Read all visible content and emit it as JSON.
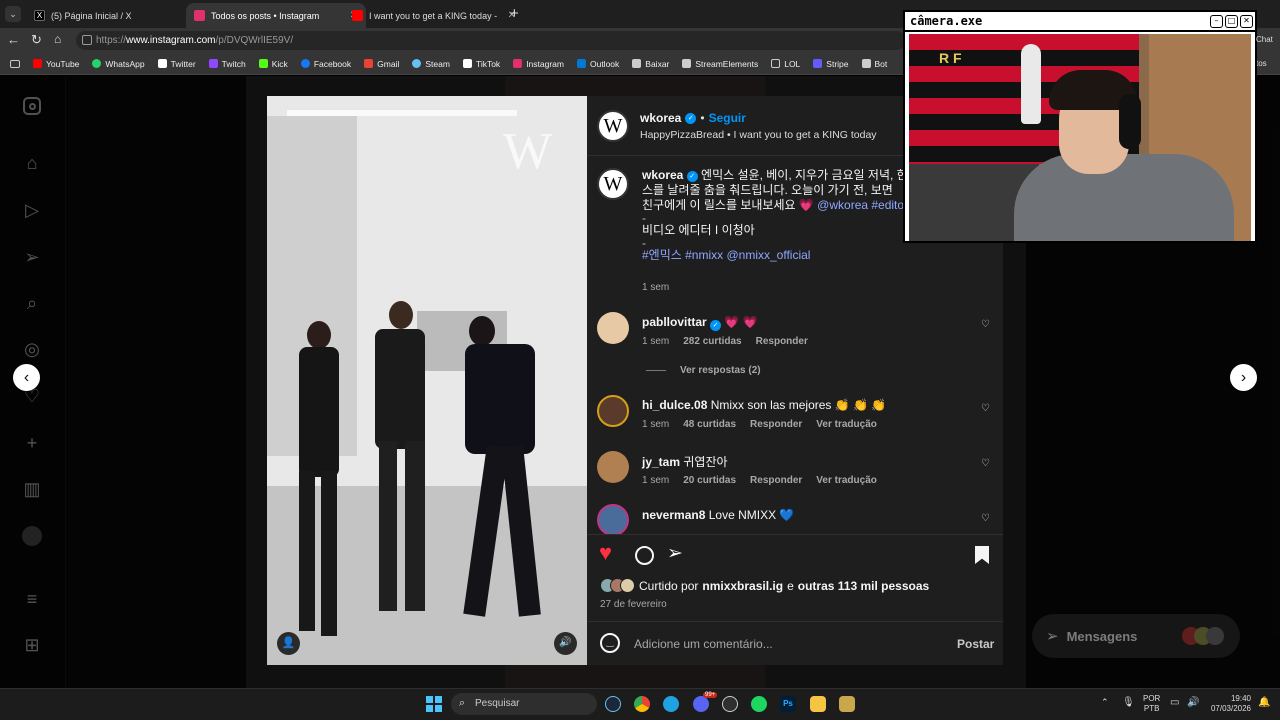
{
  "browser": {
    "tabs": [
      {
        "label": "(5) Página Inicial / X",
        "color": "#000000"
      },
      {
        "label": "Todos os posts • Instagram",
        "color": "#e1306c"
      },
      {
        "label": "I want you to get a KING today - Y",
        "color": "#ff0000"
      }
    ],
    "url_prefix": "https://",
    "url_domain": "www.instagram.com",
    "url_path": "/p/DVQWrlIE59V/",
    "bookmarks": [
      {
        "label": "YouTube",
        "color": "#ff0000"
      },
      {
        "label": "WhatsApp",
        "color": "#25d366"
      },
      {
        "label": "Twitter",
        "color": "#ffffff"
      },
      {
        "label": "Twitch",
        "color": "#9146ff"
      },
      {
        "label": "Kick",
        "color": "#53fc18"
      },
      {
        "label": "Facebook",
        "color": "#1877f2"
      },
      {
        "label": "Gmail",
        "color": "#ea4335"
      },
      {
        "label": "Steam",
        "color": "#66c0f4"
      },
      {
        "label": "TikTok",
        "color": "#ffffff"
      },
      {
        "label": "Instagram",
        "color": "#e1306c"
      },
      {
        "label": "Outlook",
        "color": "#0078d4"
      },
      {
        "label": "Baixar",
        "color": "#cccccc"
      },
      {
        "label": "StreamElements",
        "color": "#cccccc"
      },
      {
        "label": "LOL",
        "color": "#cccccc"
      },
      {
        "label": "Stripe",
        "color": "#635bff"
      },
      {
        "label": "Bot",
        "color": "#cccccc"
      }
    ],
    "overflow_text": "tos",
    "chat_text": "Chat"
  },
  "post": {
    "header_user": "wkorea",
    "follow": "Seguir",
    "audio": "HappyPizzaBread • I want you to get a KING today",
    "caption_user": "wkorea",
    "caption_line1": "엔믹스 설윤, 베이, 지우가 금요일 저녁, 한",
    "caption_line2": "스를 날려줄 춤을 춰드립니다. 오늘이 가기 전, 보면",
    "caption_line3": "친구에게 이 릴스를 보내보세요",
    "caption_tags1": "@wkorea #editor",
    "caption_dash1": "-",
    "caption_editor": "비디오 에디터 I 이청아",
    "caption_dash2": "-",
    "caption_tags2": "#엔믹스 #nmixx @nmixx_official",
    "caption_time": "1 sem",
    "likes_prefix": "Curtido por",
    "likes_user": "nmixxbrasil.ig",
    "likes_mid": "e",
    "likes_rest": "outras 113 mil pessoas",
    "date": "27 de fevereiro",
    "comment_placeholder": "Adicione um comentário...",
    "post_button": "Postar",
    "brand_letter": "W"
  },
  "comments": [
    {
      "user": "pabllovittar",
      "text": "💗 💗",
      "time": "1 sem",
      "likes": "282 curtidas",
      "reply": "Responder",
      "translate": "",
      "replies": "Ver respostas (2)"
    },
    {
      "user": "hi_dulce.08",
      "text": "Nmixx son las mejores 👏 👏 👏",
      "time": "1 sem",
      "likes": "48 curtidas",
      "reply": "Responder",
      "translate": "Ver tradução",
      "replies": ""
    },
    {
      "user": "jy_tam",
      "text": "귀엽잔아",
      "time": "1 sem",
      "likes": "20 curtidas",
      "reply": "Responder",
      "translate": "Ver tradução",
      "replies": ""
    },
    {
      "user": "neverman8",
      "text": "Love NMIXX 💙",
      "time": "",
      "likes": "",
      "reply": "",
      "translate": "",
      "replies": ""
    }
  ],
  "messages": {
    "label": "Mensagens"
  },
  "webcam": {
    "title": "câmera.exe",
    "flag_text": "R F"
  },
  "taskbar": {
    "search": "Pesquisar",
    "lang1": "POR",
    "lang2": "PTB",
    "time": "19:40",
    "date": "07/03/2026",
    "badge": "99+"
  },
  "colors": {
    "accent": "#0095f6",
    "heart": "#ff3040",
    "panel": "#1e1e1e"
  }
}
